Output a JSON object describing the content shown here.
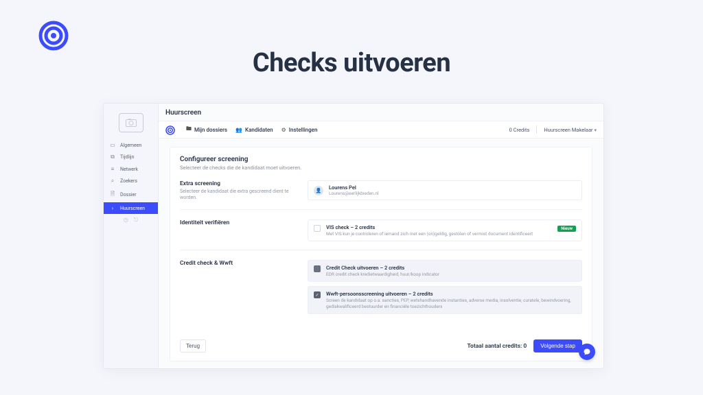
{
  "page_title": "Checks uitvoeren",
  "app": {
    "name": "Huurscreen",
    "credits_label": "0 Credits",
    "user_label": "Huurscreen Makelaar"
  },
  "nav": {
    "items": [
      {
        "icon": "folder-icon",
        "label": "Mijn dossiers"
      },
      {
        "icon": "people-icon",
        "label": "Kandidaten"
      },
      {
        "icon": "gear-icon",
        "label": "Instellingen"
      }
    ]
  },
  "sidebar": {
    "items": [
      {
        "icon": "folder-outline-icon",
        "label": "Algemeen"
      },
      {
        "icon": "timeline-icon",
        "label": "Tijdlijn"
      },
      {
        "icon": "list-icon",
        "label": "Netwerk"
      },
      {
        "icon": "search-icon",
        "label": "Zoekers"
      },
      {
        "icon": "file-icon",
        "label": "Dossier"
      },
      {
        "icon": "chevron-right-icon",
        "label": "Huurscreen",
        "active": true
      }
    ]
  },
  "card": {
    "title": "Configureer screening",
    "subtitle": "Selecteer de checks die de kandidaat moet uitvoeren."
  },
  "section_extra": {
    "title": "Extra screening",
    "desc": "Selecteer de kandidaat die extra gescreend dient te worden.",
    "person": {
      "name": "Lourens Pel",
      "email": "Lourens@eerlijkbieden.nl"
    }
  },
  "section_identity": {
    "title": "Identiteit verifiëren",
    "option": {
      "title": "VIS check – 2 credits",
      "desc": "Met VIS kun je controleren of iemand zich met een (on)geldig, gestolen of vermist document identificeert",
      "badge": "Nieuw"
    }
  },
  "section_credit": {
    "title": "Credit check & Wwft",
    "option1": {
      "title": "Credit Check uitvoeren – 2 credits",
      "desc": "EDR credit check kredietwaardigheid, huur/koop indicator"
    },
    "option2": {
      "title": "Wwft-persoonsscreening uitvoeren – 2 credits",
      "desc": "Screen de kandidaat op o.a. sancties, PEP, wetshandhavende instanties, adverse media, insolventie, curatele, bewindvoering, gediskwalificeerd bestuurder en financiële toezichthouders"
    }
  },
  "footer": {
    "back": "Terug",
    "total_label": "Totaal aantal credits:",
    "total_value": "0",
    "next": "Volgende stap"
  },
  "colors": {
    "brand": "#3d4cfb"
  }
}
